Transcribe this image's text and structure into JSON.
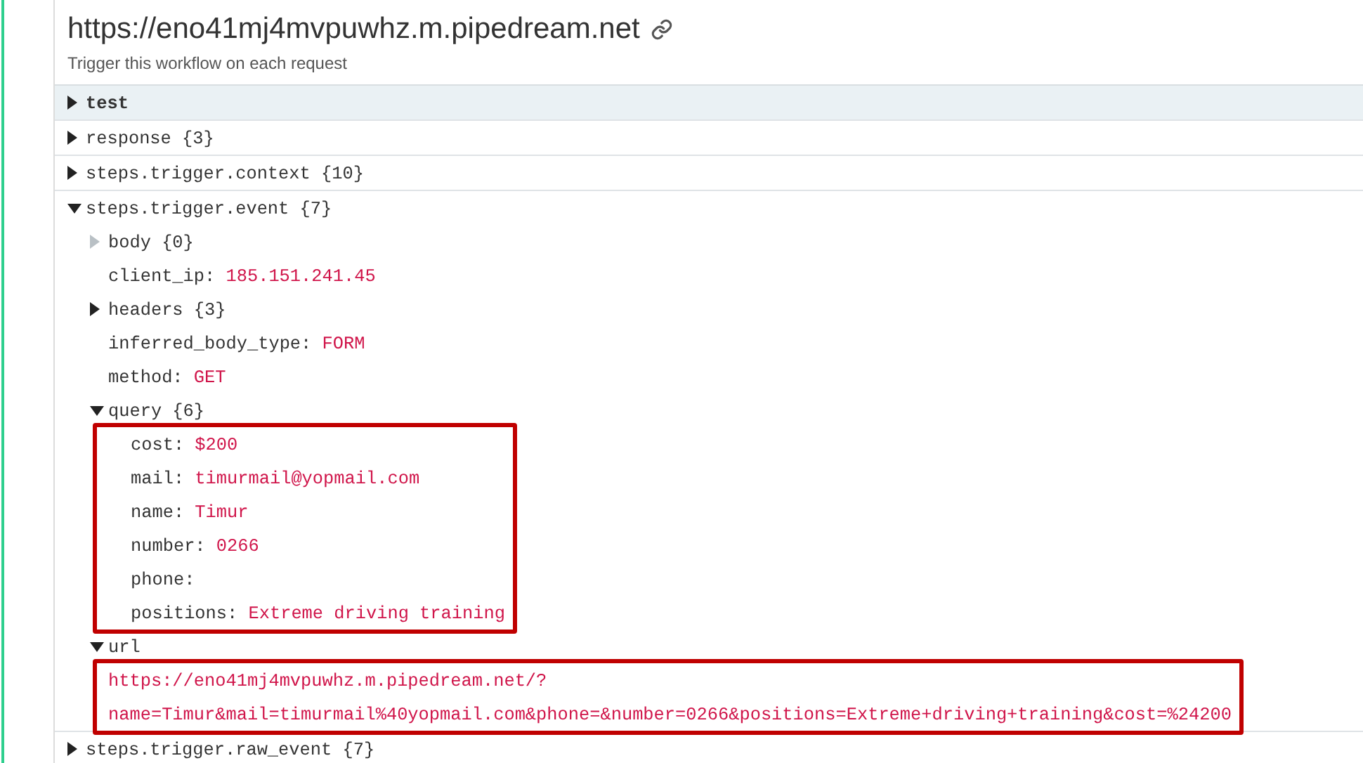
{
  "header": {
    "title": "https://eno41mj4mvpuwhz.m.pipedream.net",
    "subtitle": "Trigger this workflow on each request"
  },
  "tree": [
    {
      "key": "test",
      "selected": true,
      "expanded": false
    },
    {
      "key": "response",
      "count": "{3}",
      "selected": false,
      "expanded": false
    },
    {
      "key": "steps.trigger.context",
      "count": "{10}",
      "selected": false,
      "expanded": false
    },
    {
      "key": "steps.trigger.event",
      "count": "{7}",
      "selected": false,
      "expanded": true,
      "children": [
        {
          "key": "body",
          "count": "{0}",
          "expanded": false,
          "disabled": true
        },
        {
          "key": "client_ip:",
          "value": "185.151.241.45"
        },
        {
          "key": "headers",
          "count": "{3}",
          "expanded": false
        },
        {
          "key": "inferred_body_type:",
          "value": "FORM"
        },
        {
          "key": "method:",
          "value": "GET"
        },
        {
          "key": "query",
          "count": "{6}",
          "expanded": true,
          "highlighted": true,
          "children": [
            {
              "key": "cost:",
              "value": "$200"
            },
            {
              "key": "mail:",
              "value": "timurmail@yopmail.com"
            },
            {
              "key": "name:",
              "value": "Timur"
            },
            {
              "key": "number:",
              "value": "0266"
            },
            {
              "key": "phone:"
            },
            {
              "key": "positions:",
              "value": "Extreme driving training"
            }
          ]
        },
        {
          "key": "url",
          "expanded": true,
          "highlighted": true,
          "lines": [
            "https://eno41mj4mvpuwhz.m.pipedream.net/?",
            "name=Timur&mail=timurmail%40yopmail.com&phone=&number=0266&positions=Extreme+driving+training&cost=%24200"
          ]
        }
      ]
    },
    {
      "key": "steps.trigger.raw_event",
      "count": "{7}",
      "selected": false,
      "expanded": false
    }
  ]
}
